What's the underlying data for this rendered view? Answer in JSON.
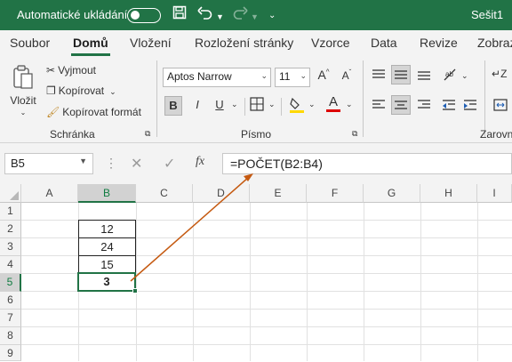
{
  "titlebar": {
    "autosave_label": "Automatické ukládání",
    "doc_title": "Sešit1",
    "bg": "#217346"
  },
  "tabs": [
    "Soubor",
    "Domů",
    "Vložení",
    "Rozložení stránky",
    "Vzorce",
    "Data",
    "Revize",
    "Zobraz"
  ],
  "ribbon": {
    "clipboard": {
      "paste_label": "Vložit",
      "cut_label": "Vyjmout",
      "copy_label": "Kopírovat",
      "format_painter_label": "Kopírovat formát",
      "group_label": "Schránka"
    },
    "font": {
      "font_name": "Aptos Narrow",
      "font_size": "11",
      "grow_label": "A",
      "shrink_label": "A",
      "bold_label": "B",
      "italic_label": "I",
      "underline_label": "U",
      "fill_label": "A",
      "group_label": "Písmo"
    },
    "alignment": {
      "group_label": "Zarovn",
      "wrap_label": "Z"
    }
  },
  "formula_bar": {
    "name_box": "B5",
    "fx_label": "fx",
    "formula": "=POČET(B2:B4)"
  },
  "grid": {
    "columns": [
      "A",
      "B",
      "C",
      "D",
      "E",
      "F",
      "G",
      "H",
      "I"
    ],
    "rows": [
      "1",
      "2",
      "3",
      "4",
      "5",
      "6",
      "7",
      "8",
      "9"
    ],
    "cells": {
      "B2": "12",
      "B3": "24",
      "B4": "15",
      "B5": "3"
    },
    "selected_cell": "B5"
  },
  "colors": {
    "accent": "#217346",
    "arrow": "#c55a11"
  }
}
